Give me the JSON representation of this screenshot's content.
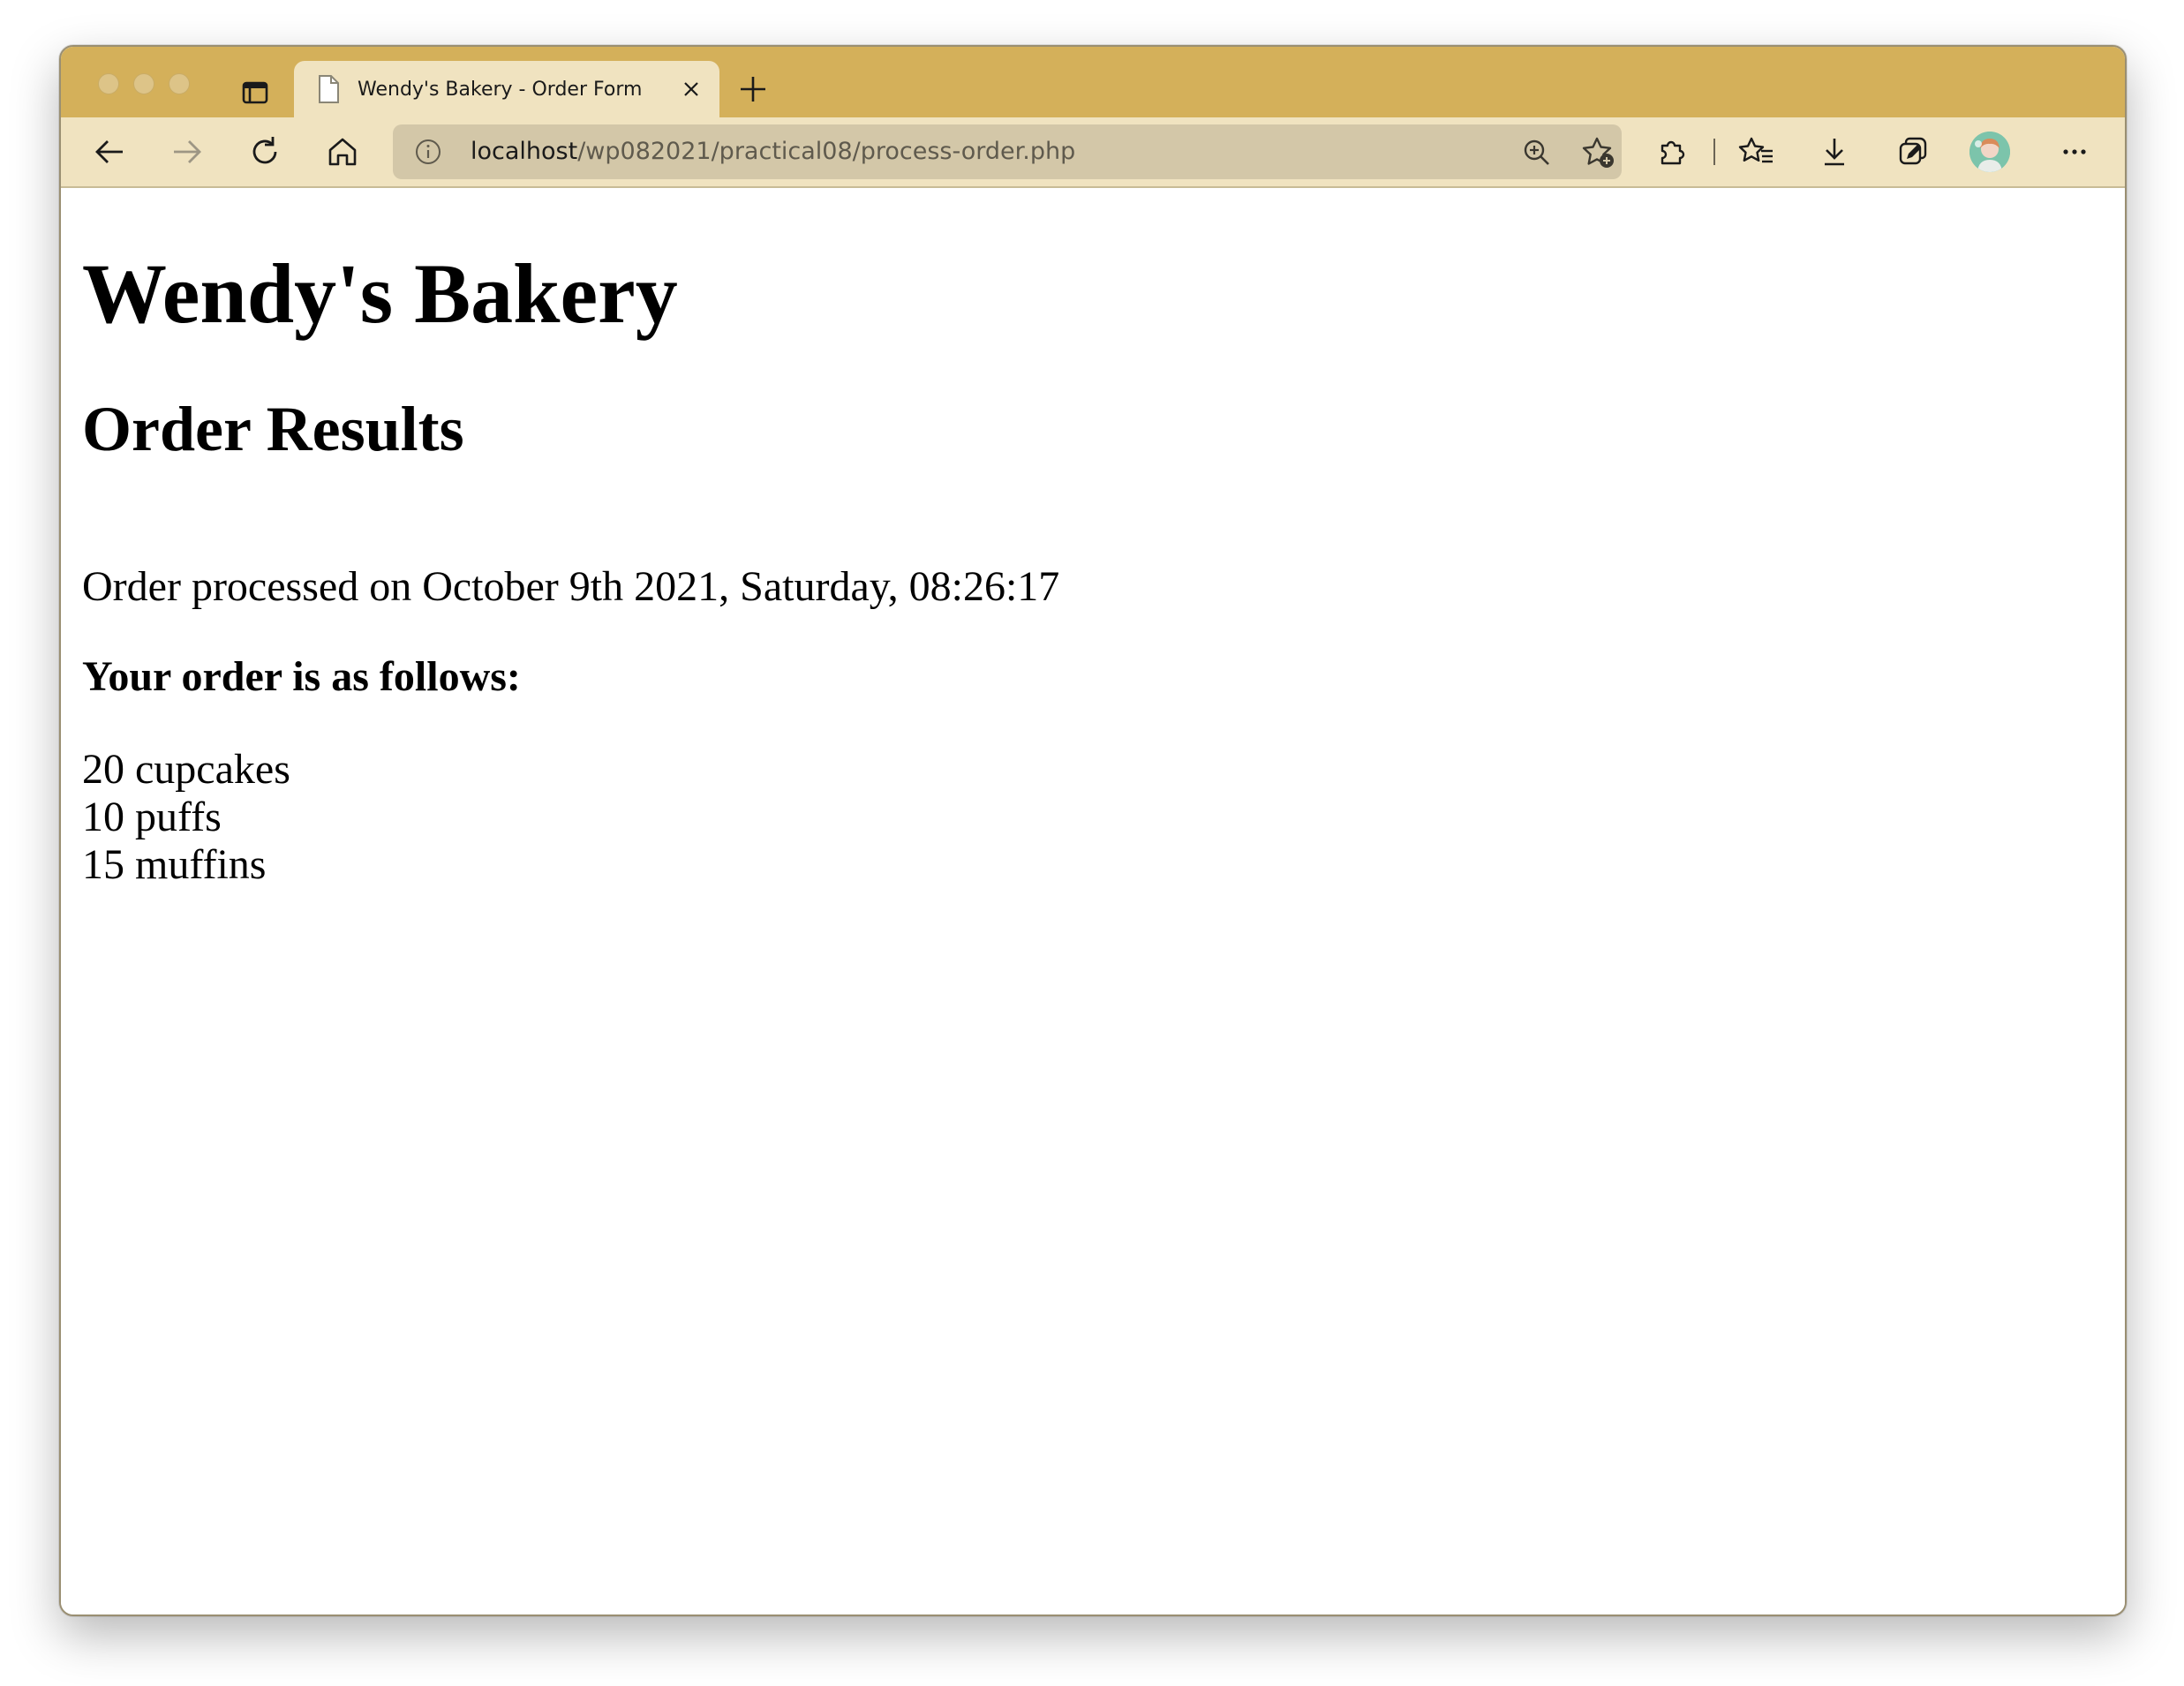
{
  "browser": {
    "tab": {
      "title": "Wendy's Bakery - Order Form"
    },
    "address_bar": {
      "host": "localhost",
      "path": "/wp082021/practical08/process-order.php"
    },
    "colors": {
      "tabstrip": "#d4b05a",
      "toolbar": "#f0e3c0",
      "address_field": "#d3c7a8"
    },
    "toolbar_icons": [
      "back-icon",
      "forward-icon",
      "refresh-icon",
      "home-icon",
      "site-info-icon",
      "zoom-icon",
      "add-favorite-icon",
      "extensions-icon",
      "favorites-icon",
      "downloads-icon",
      "collections-icon",
      "profile-avatar",
      "more-icon"
    ]
  },
  "page": {
    "site_title": "Wendy's Bakery",
    "section_title": "Order Results",
    "processed_text": "Order processed on October 9th 2021, Saturday, 08:26:17",
    "order_heading": "Your order is as follows:",
    "order_items": [
      "20 cupcakes",
      "10 puffs",
      "15 muffins"
    ]
  }
}
